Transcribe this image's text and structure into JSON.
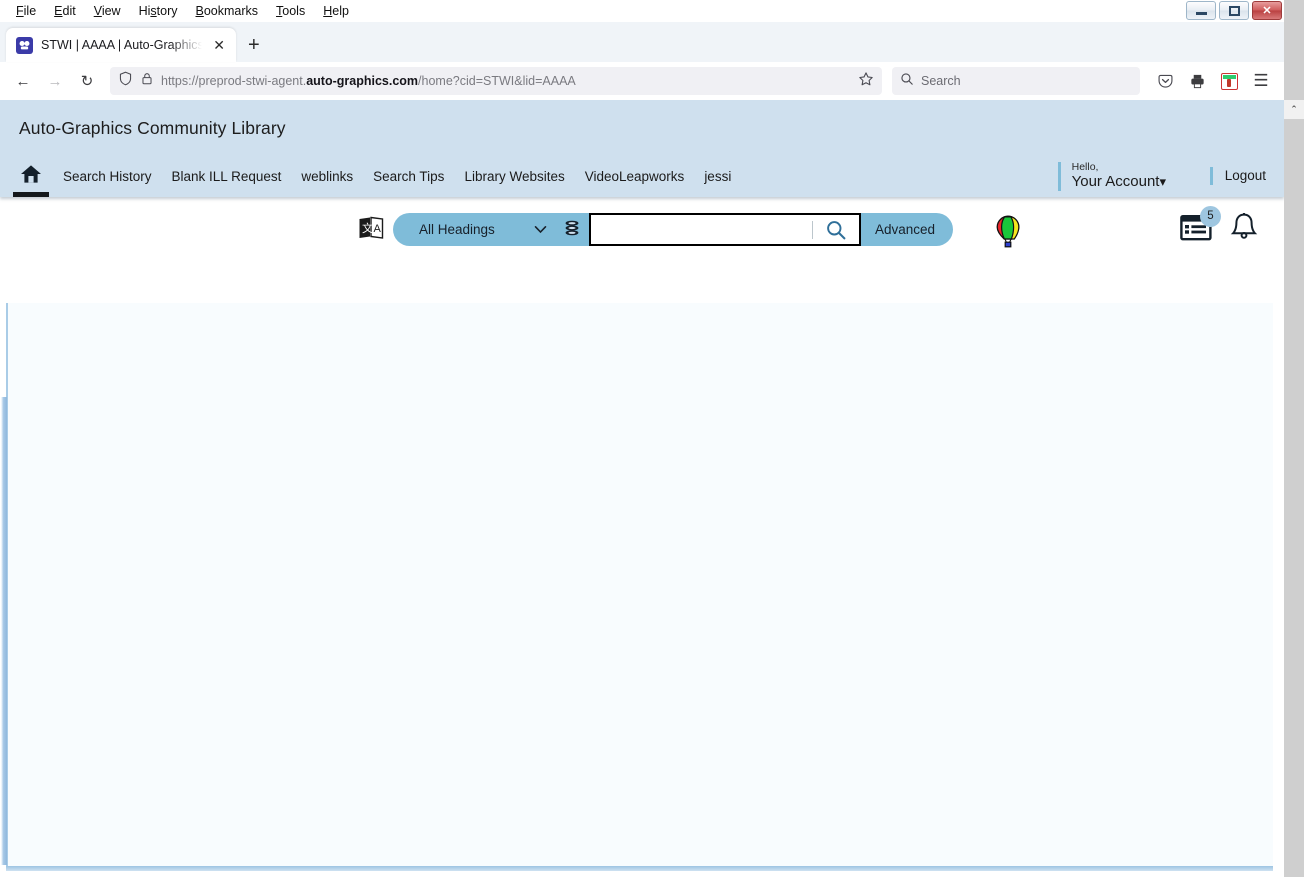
{
  "window": {
    "minimize_label": "Minimize",
    "maximize_label": "Maximize",
    "close_label": "✕"
  },
  "menubar": {
    "items": [
      {
        "label": "File"
      },
      {
        "label": "Edit"
      },
      {
        "label": "View"
      },
      {
        "label": "History"
      },
      {
        "label": "Bookmarks"
      },
      {
        "label": "Tools"
      },
      {
        "label": "Help"
      }
    ]
  },
  "tabstrip": {
    "tab_title": "STWI | AAAA | Auto-Graphics In",
    "favicon_glyph": "❦",
    "close_glyph": "✕",
    "newtab_glyph": "+"
  },
  "navbar": {
    "back_glyph": "←",
    "forward_glyph": "→",
    "reload_glyph": "↻",
    "url_prefix": "https://preprod-stwi-agent.",
    "url_domain": "auto-graphics.com",
    "url_suffix": "/home?cid=STWI&lid=AAAA",
    "bookmark_glyph": "☆",
    "search_placeholder": "Search",
    "search_glyph": "⌕",
    "pocket_glyph": "✓",
    "print_glyph": "⎙",
    "menu_glyph": "☰"
  },
  "app": {
    "library_title": "Auto-Graphics Community Library",
    "translate_icon": "translate-icon",
    "dropdown_value": "All Headings",
    "dropdown_chevron": "⌄",
    "database_icon": "database-icon",
    "search_input_value": "",
    "search_input_placeholder": "",
    "search_button_glyph": "⌕",
    "advanced_label": "Advanced",
    "balloon_icon": "hot-air-balloon-icon",
    "news_badge_count": "5",
    "bell_icon": "notification-bell-icon"
  },
  "nav": {
    "home_icon": "home-icon",
    "links": [
      {
        "label": "Search History"
      },
      {
        "label": "Blank ILL Request"
      },
      {
        "label": "weblinks"
      },
      {
        "label": "Search Tips"
      },
      {
        "label": "Library Websites"
      },
      {
        "label": "VideoLeapworks"
      },
      {
        "label": "jessi"
      }
    ]
  },
  "account": {
    "greeting": "Hello,",
    "name": "Your Account",
    "chevron": "⌄",
    "logout_label": "Logout"
  },
  "scrollbar": {
    "up_glyph": "⌃"
  },
  "colors": {
    "header_bg": "#cfe0ee",
    "accent": "#7fbcd9",
    "badge_bg": "#9ec6e0",
    "frame_border": "#a9cce7",
    "content_bg": "#f8fcfe"
  }
}
